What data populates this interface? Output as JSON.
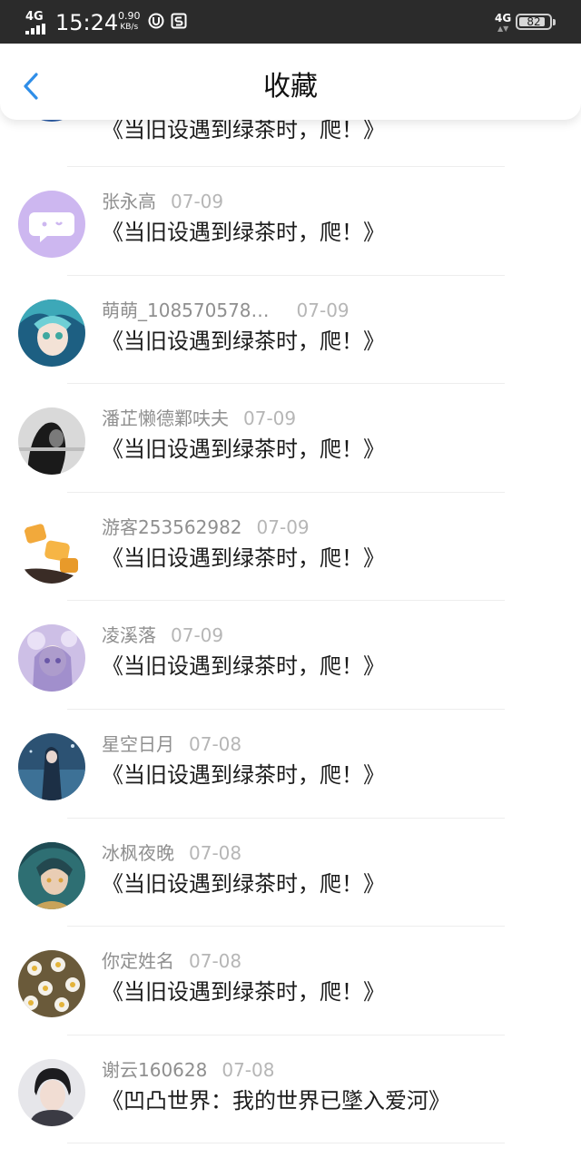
{
  "status_bar": {
    "network": "4G",
    "time": "15:24",
    "speed_value": "0.90",
    "speed_unit": "KB/s",
    "network_right": "4G",
    "battery": "82"
  },
  "header": {
    "title": "收藏",
    "back_icon": "chevron-left-icon"
  },
  "favorites": [
    {
      "name": "",
      "date": "",
      "text": "《当旧设遇到绿茶时，爬！》",
      "avatar": "anime-blue-hair"
    },
    {
      "name": "张永高",
      "date": "07-09",
      "text": "《当旧设遇到绿茶时，爬！》",
      "avatar": "default-chat-bubble"
    },
    {
      "name": "萌萌_108570578…",
      "date": "07-09",
      "text": "《当旧设遇到绿茶时，爬！》",
      "avatar": "anime-teal-girl"
    },
    {
      "name": "潘芷懒德鄴呋夫",
      "date": "07-09",
      "text": "《当旧设遇到绿茶时，爬！》",
      "avatar": "monochrome-woman"
    },
    {
      "name": "游客253562982",
      "date": "07-09",
      "text": "《当旧设遇到绿茶时，爬！》",
      "avatar": "orange-objects"
    },
    {
      "name": "凌溪落",
      "date": "07-09",
      "text": "《当旧设遇到绿茶时，爬！》",
      "avatar": "anime-purple-girl"
    },
    {
      "name": "星空日月",
      "date": "07-08",
      "text": "《当旧设遇到绿茶时，爬！》",
      "avatar": "anime-blue-night"
    },
    {
      "name": "冰枫夜晚",
      "date": "07-08",
      "text": "《当旧设遇到绿茶时，爬！》",
      "avatar": "anime-green-boy"
    },
    {
      "name": "你定姓名",
      "date": "07-08",
      "text": "《当旧设遇到绿茶时，爬！》",
      "avatar": "daisy-flowers"
    },
    {
      "name": "谢云160628",
      "date": "07-08",
      "text": "《凹凸世界：我的世界已墜入爱河》",
      "avatar": "boy-portrait"
    }
  ],
  "colors": {
    "accent": "#2f8ee8",
    "name_gray": "#8f8f8f",
    "date_gray": "#b6b6b6",
    "status_bar_bg": "#2b2b2b"
  }
}
